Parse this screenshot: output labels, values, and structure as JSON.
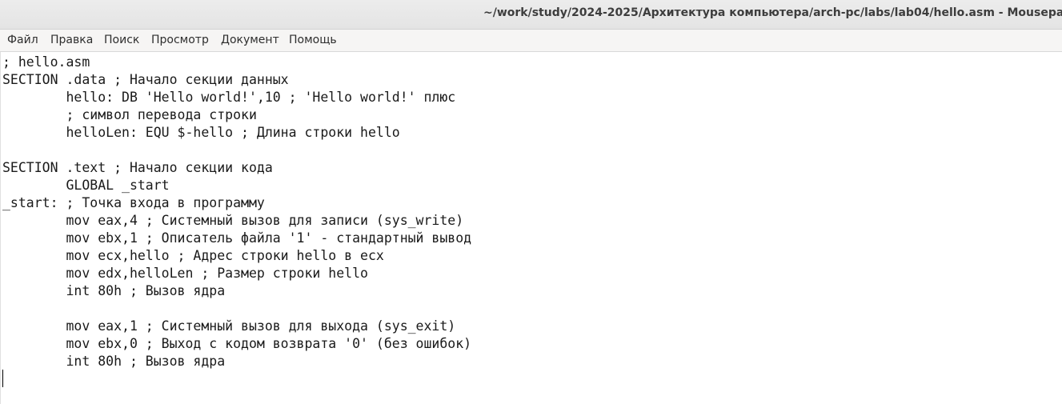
{
  "window": {
    "title": "~/work/study/2024-2025/Архитектура компьютера/arch-pc/labs/lab04/hello.asm - Mousepad"
  },
  "menu": {
    "items": [
      "Файл",
      "Правка",
      "Поиск",
      "Просмотр",
      "Документ",
      "Помощь"
    ]
  },
  "editor": {
    "lines": [
      "; hello.asm",
      "SECTION .data ; Начало секции данных",
      "        hello: DB 'Hello world!',10 ; 'Hello world!' плюс",
      "        ; символ перевода строки",
      "        helloLen: EQU $-hello ; Длина строки hello",
      "",
      "SECTION .text ; Начало секции кода",
      "        GLOBAL _start",
      "_start: ; Точка входа в программу",
      "        mov eax,4 ; Системный вызов для записи (sys_write)",
      "        mov ebx,1 ; Описатель файла '1' - стандартный вывод",
      "        mov ecx,hello ; Адрес строки hello в ecx",
      "        mov edx,helloLen ; Размер строки hello",
      "        int 80h ; Вызов ядра",
      "",
      "        mov eax,1 ; Системный вызов для выхода (sys_exit)",
      "        mov ebx,0 ; Выход с кодом возврата '0' (без ошибок)",
      "        int 80h ; Вызов ядра",
      ""
    ]
  }
}
